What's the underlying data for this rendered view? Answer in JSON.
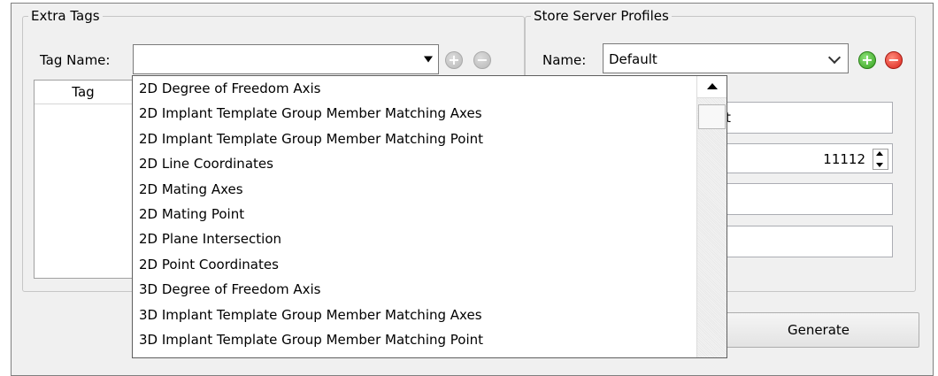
{
  "extra_tags": {
    "title": "Extra Tags",
    "tag_name_label": "Tag Name:",
    "tag_name_value": "",
    "table_header": "Tag"
  },
  "store_server": {
    "title": "Store Server Profiles",
    "name_label": "Name:",
    "name_value": "Default",
    "field1_visible": "t",
    "port": "11112",
    "field3": "",
    "field4": ""
  },
  "buttons": {
    "generate": "Generate"
  },
  "dropdown": {
    "items": [
      "2D Degree of Freedom Axis",
      "2D Implant Template Group Member Matching Axes",
      "2D Implant Template Group Member Matching Point",
      "2D Line Coordinates",
      "2D Mating Axes",
      "2D Mating Point",
      "2D Plane Intersection",
      "2D Point Coordinates",
      "3D Degree of Freedom Axis",
      "3D Implant Template Group Member Matching Axes",
      "3D Implant Template Group Member Matching Point"
    ]
  }
}
